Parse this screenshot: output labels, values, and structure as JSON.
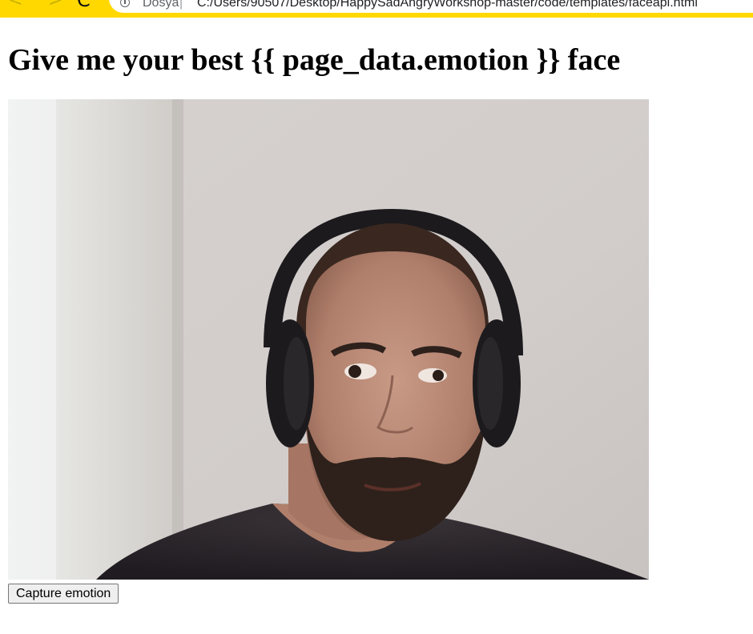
{
  "browser": {
    "back_glyph": "<",
    "forward_glyph": ">",
    "reload_glyph": "C",
    "address": {
      "scheme_label": "Dosya",
      "separator": "|",
      "url": "C:/Users/90507/Desktop/HappySadAngryWorkshop-master/code/templates/faceapi.html"
    },
    "toolbar_color": "#ffd800"
  },
  "page": {
    "title": "Give me your best {{ page_data.emotion }} face",
    "video": {
      "alt": "webcam feed"
    },
    "capture_button": "Capture emotion"
  }
}
